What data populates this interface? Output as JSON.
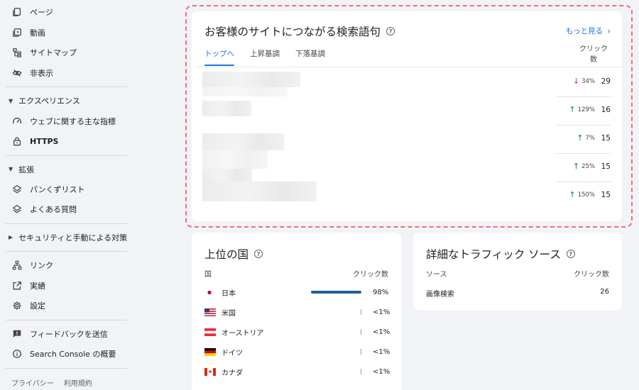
{
  "sidebar": {
    "items_top": [
      {
        "label": "ページ",
        "icon": "page-icon"
      },
      {
        "label": "動画",
        "icon": "video-icon"
      },
      {
        "label": "サイトマップ",
        "icon": "sitemap-icon"
      },
      {
        "label": "非表示",
        "icon": "hidden-icon"
      }
    ],
    "section_experience": "エクスペリエンス",
    "items_experience": [
      {
        "label": "ウェブに関する主な指標",
        "icon": "gauge-icon"
      },
      {
        "label": "HTTPS",
        "icon": "lock-icon"
      }
    ],
    "section_enhancements": "拡張",
    "items_enhancements": [
      {
        "label": "パンくずリスト",
        "icon": "layers-icon"
      },
      {
        "label": "よくある質問",
        "icon": "layers-icon"
      }
    ],
    "section_security": "セキュリティと手動による対策",
    "items_links": [
      {
        "label": "リンク",
        "icon": "network-icon"
      },
      {
        "label": "実績",
        "icon": "external-icon"
      },
      {
        "label": "設定",
        "icon": "gear-icon"
      }
    ],
    "items_bottom": [
      {
        "label": "フィードバックを送信",
        "icon": "feedback-icon"
      },
      {
        "label": "Search Console の概要",
        "icon": "info-icon"
      }
    ],
    "footer_privacy": "プライバシー",
    "footer_terms": "利用規約"
  },
  "queries_card": {
    "title": "お客様のサイトにつながる検索語句",
    "more_link": "もっと見る",
    "tabs": [
      "トップへ",
      "上昇基調",
      "下落基調"
    ],
    "column_header_line1": "クリック",
    "column_header_line2": "数",
    "rows": [
      {
        "trend": "down",
        "pct": "34%",
        "clicks": "29"
      },
      {
        "trend": "up",
        "pct": "129%",
        "clicks": "16"
      },
      {
        "trend": "up",
        "pct": "7%",
        "clicks": "15"
      },
      {
        "trend": "up",
        "pct": "25%",
        "clicks": "15"
      },
      {
        "trend": "up",
        "pct": "150%",
        "clicks": "15"
      }
    ]
  },
  "countries_card": {
    "title": "上位の国",
    "col_country": "国",
    "col_clicks": "クリック数",
    "rows": [
      {
        "name": "日本",
        "flag": "japan-flag-icon",
        "pct": "98%",
        "share": 0.98
      },
      {
        "name": "米国",
        "flag": "usa-flag-icon",
        "pct": "<1%",
        "share": 0.01
      },
      {
        "name": "オーストリア",
        "flag": "austria-flag-icon",
        "pct": "<1%",
        "share": 0.01
      },
      {
        "name": "ドイツ",
        "flag": "germany-flag-icon",
        "pct": "<1%",
        "share": 0.01
      },
      {
        "name": "カナダ",
        "flag": "canada-flag-icon",
        "pct": "<1%",
        "share": 0.01
      }
    ]
  },
  "sources_card": {
    "title": "詳細なトラフィック ソース",
    "col_source": "ソース",
    "col_clicks": "クリック数",
    "row_label": "画像検索",
    "row_value": "26"
  },
  "colors": {
    "accent": "#1a73e8",
    "highlight": "#ef6e74",
    "up": "#188038",
    "down": "#d93025",
    "bar": "#1e5f99"
  }
}
